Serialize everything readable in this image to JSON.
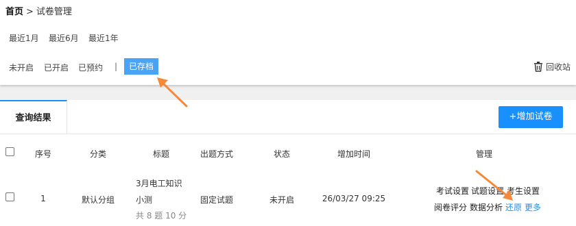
{
  "breadcrumb": {
    "home": "首页",
    "separator": ">",
    "current": "试卷管理"
  },
  "periods": [
    "最近1月",
    "最近6月",
    "最近1年"
  ],
  "status_filters": [
    "未开启",
    "已开启",
    "已预约"
  ],
  "filter_divider": "|",
  "active_filter": "已存档",
  "recycle_label": "回收站",
  "results_tab": "查询结果",
  "add_button": "+增加试卷",
  "columns": [
    "序号",
    "分类",
    "标题",
    "出题方式",
    "状态",
    "增加时间",
    "管理"
  ],
  "row": {
    "index": "1",
    "category": "默认分组",
    "title_line1": "3月电工知识",
    "title_line2": "小测",
    "title_sub": "共 8 题 10 分",
    "method": "固定试题",
    "status": "未开启",
    "time": "26/03/27 09:25",
    "actions_line1": [
      "考试设置",
      "试题设置",
      "考生设置"
    ],
    "actions_line2": [
      "阅卷评分",
      "数据分析",
      "还原",
      "更多"
    ]
  },
  "colors": {
    "accent": "#1890ff",
    "active_filter_bg": "#4aa3f5",
    "annotation_arrow": "#f5893a"
  }
}
